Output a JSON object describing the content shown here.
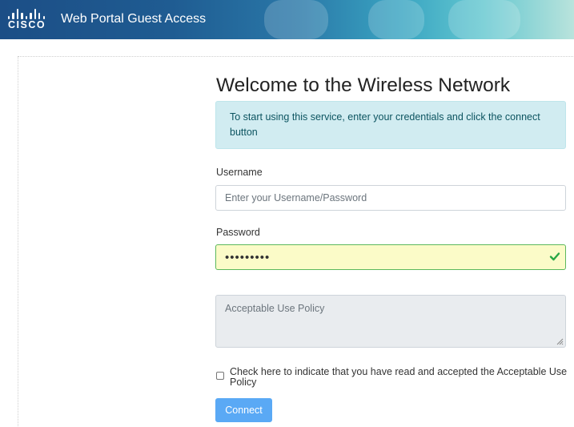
{
  "header": {
    "brand": "CISCO",
    "title": "Web Portal Guest Access",
    "brand_color": "#1c4e86"
  },
  "main": {
    "heading": "Welcome to the Wireless Network",
    "info_text": "To start using this service, enter your credentials and click the connect button",
    "username": {
      "label": "Username",
      "placeholder": "Enter your Username/Password",
      "value": ""
    },
    "password": {
      "label": "Password",
      "value": "•••••••••",
      "valid_icon": "checkmark-icon",
      "valid_color": "#5cb85c"
    },
    "aup": {
      "placeholder": "Acceptable Use Policy"
    },
    "accept_checkbox": {
      "label": "Check here to indicate that you have read and accepted the Acceptable Use Policy",
      "checked": false
    },
    "connect_button": {
      "label": "Connect",
      "color": "#5aa9f5"
    }
  }
}
